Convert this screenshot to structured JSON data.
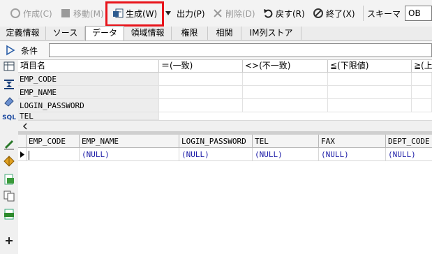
{
  "toolbar": {
    "create": "作成(C)",
    "move": "移動(M)",
    "generate": "生成(W)",
    "output": "出力(P)",
    "delete": "削除(D)",
    "revert": "戻す(R)",
    "exit": "終了(X)",
    "schema_label": "スキーマ",
    "schema_value": "OB"
  },
  "tabs": [
    "定義情報",
    "ソース",
    "データ",
    "領域情報",
    "権限",
    "相関",
    "IM列ストア"
  ],
  "condition": {
    "label": "条件",
    "value": ""
  },
  "filter_grid": {
    "headers": [
      "項目名",
      "＝(一致)",
      "<>(不一致)",
      "≦(下限値)",
      "≧(上"
    ],
    "rows": [
      "EMP_CODE",
      "EMP_NAME",
      "LOGIN_PASSWORD",
      "TEL"
    ]
  },
  "data_grid": {
    "headers": [
      "EMP_CODE",
      "EMP_NAME",
      "LOGIN_PASSWORD",
      "TEL",
      "FAX",
      "DEPT_CODE"
    ],
    "row": [
      "",
      "(NULL)",
      "(NULL)",
      "(NULL)",
      "(NULL)",
      "(NULL)"
    ]
  },
  "colors": {
    "highlight": "#e8141b",
    "null_text": "#1a1aa6"
  },
  "icons": [
    "circle-icon",
    "move-icon",
    "generate-icon",
    "dropdown-icon",
    "close-x-icon",
    "undo-icon",
    "no-icon",
    "table-icon",
    "collapse-icon",
    "eraser-icon",
    "sql-icon",
    "pencil-icon",
    "split-icon",
    "grid-doc-icon",
    "copy-icon",
    "csv-icon",
    "plus-icon"
  ]
}
